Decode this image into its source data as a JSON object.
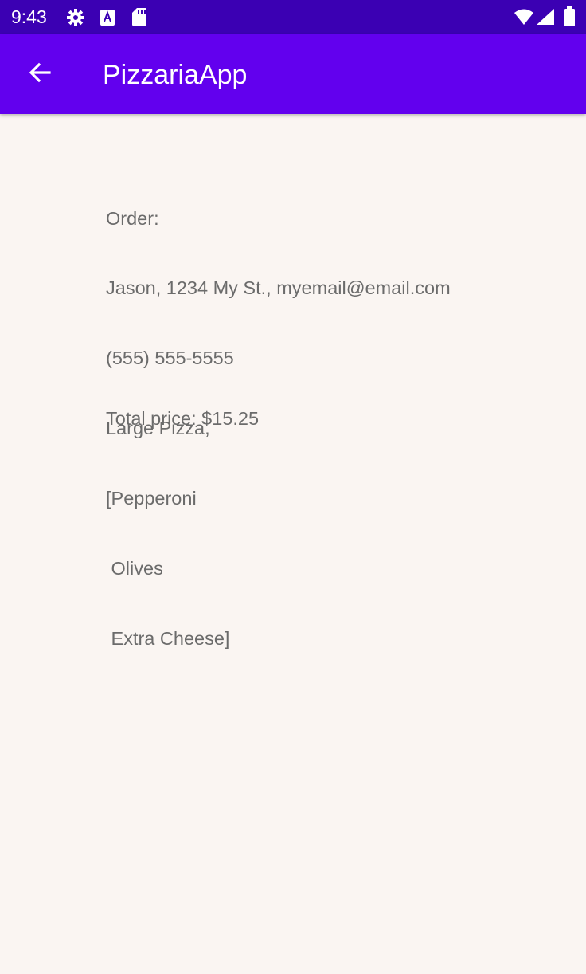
{
  "status_bar": {
    "time": "9:43",
    "icons_left": [
      "gear-icon",
      "a-badge-icon",
      "sd-card-icon"
    ],
    "icons_right": [
      "wifi-icon",
      "signal-icon",
      "battery-icon"
    ]
  },
  "app_bar": {
    "title": "PizzariaApp",
    "back_icon": "arrow-back-icon"
  },
  "order": {
    "lines": [
      "Order:",
      "Jason, 1234 My St., myemail@email.com",
      "(555) 555-5555",
      "Large Pizza,",
      "[Pepperoni",
      " Olives",
      " Extra Cheese]"
    ],
    "total": "Total price: $15.25"
  },
  "colors": {
    "status_bar": "#3b00b3",
    "app_bar": "#6200ee",
    "background": "#faf5f2",
    "body_text": "#6b6b6b"
  }
}
